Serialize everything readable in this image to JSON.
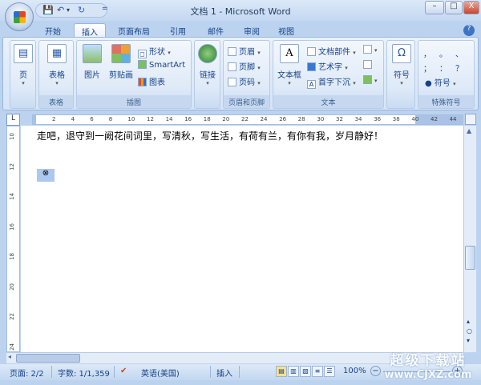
{
  "window": {
    "title": "文档 1 - Microsoft Word",
    "minimize": "–",
    "maximize": "□",
    "close": "X"
  },
  "qat": {
    "save": "💾",
    "undo": "↶",
    "undo_drop": "▾",
    "redo": "↻",
    "customize": "="
  },
  "tabs": [
    {
      "label": "开始"
    },
    {
      "label": "插入",
      "active": true
    },
    {
      "label": "页面布局"
    },
    {
      "label": "引用"
    },
    {
      "label": "邮件"
    },
    {
      "label": "审阅"
    },
    {
      "label": "视图"
    }
  ],
  "help": "?",
  "ribbon": {
    "groups": {
      "page": {
        "button": "页"
      },
      "table": {
        "button": "表格",
        "label": "表格"
      },
      "illustrations": {
        "picture": "图片",
        "clipart": "剪贴画",
        "shapes": "形状",
        "smartart": "SmartArt",
        "chart": "图表",
        "label": "插图"
      },
      "links": {
        "button": "链接"
      },
      "header_footer": {
        "header": "页眉",
        "footer": "页脚",
        "page_number": "页码",
        "label": "页眉和页脚"
      },
      "text": {
        "textbox": "文本框",
        "quick_parts": "文档部件",
        "wordart": "艺术字",
        "dropcap": "首字下沉",
        "label": "文本"
      },
      "symbols": {
        "button": "符号",
        "button_icon": "Ω"
      },
      "special": {
        "chars": [
          "，",
          "。",
          "、",
          "；",
          "：",
          "？"
        ],
        "symbol": "符号",
        "label": "特殊符号"
      }
    }
  },
  "ruler": {
    "corner": "L",
    "h_ticks": [
      "2",
      "4",
      "6",
      "8",
      "10",
      "12",
      "14",
      "16",
      "18",
      "20",
      "22",
      "24",
      "26",
      "28",
      "30",
      "32",
      "34",
      "36",
      "38",
      "40",
      "42",
      "44"
    ],
    "v_ticks": [
      "10",
      "12",
      "14",
      "16",
      "18",
      "20",
      "22",
      "24"
    ]
  },
  "document": {
    "text": "走吧，退守到一阙花间词里，写清秋，写生活，有荷有兰，有你有我，岁月静好！",
    "anchor": "⊗"
  },
  "status": {
    "page": "页面: 2/2",
    "words": "字数: 1/1,359",
    "language": "英语(美国)",
    "mode": "插入",
    "zoom": "100%",
    "zoom_out": "−",
    "zoom_in": "+"
  },
  "watermark": {
    "line1": "超级下载站",
    "line2": "www.CJXZ.com"
  }
}
